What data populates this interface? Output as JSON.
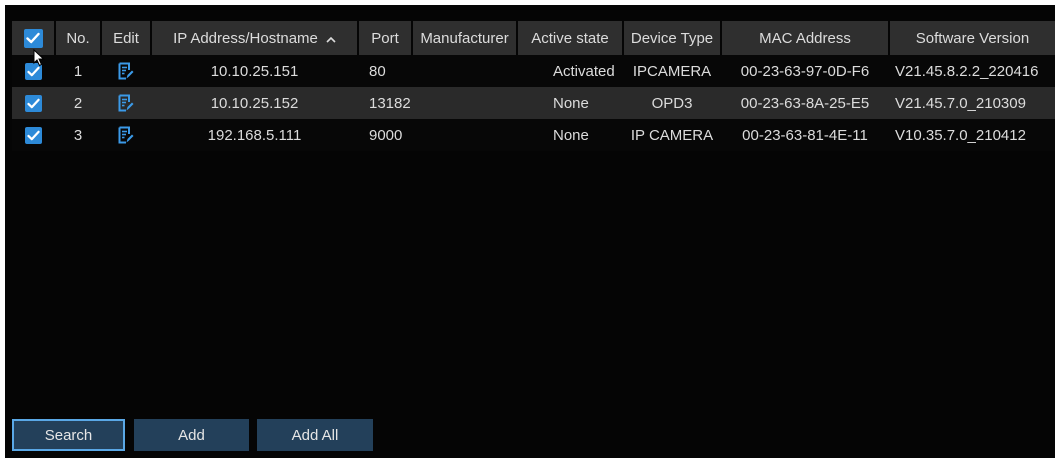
{
  "table": {
    "columns": [
      "",
      "No.",
      "Edit",
      "IP Address/Hostname",
      "Port",
      "Manufacturer",
      "Active state",
      "Device Type",
      "MAC Address",
      "Software Version"
    ],
    "sort_column": "IP Address/Hostname",
    "sort_direction": "ascending",
    "select_all_checked": true,
    "rows": [
      {
        "checked": true,
        "no": "1",
        "ip": "10.10.25.151",
        "port": "80",
        "manufacturer": "",
        "active_state": "Activated",
        "device_type": "IPCAMERA",
        "mac": "00-23-63-97-0D-F6",
        "version": "V21.45.8.2.2_220416"
      },
      {
        "checked": true,
        "no": "2",
        "ip": "10.10.25.152",
        "port": "13182",
        "manufacturer": "",
        "active_state": "None",
        "device_type": "OPD3",
        "mac": "00-23-63-8A-25-E5",
        "version": "V21.45.7.0_210309"
      },
      {
        "checked": true,
        "no": "3",
        "ip": "192.168.5.111",
        "port": "9000",
        "manufacturer": "",
        "active_state": "None",
        "device_type": "IP CAMERA",
        "mac": "00-23-63-81-4E-11",
        "version": "V10.35.7.0_210412"
      }
    ]
  },
  "buttons": {
    "search": "Search",
    "add": "Add",
    "add_all": "Add All"
  },
  "icons": {
    "checkbox": "checkmark-icon",
    "edit": "edit-icon",
    "sort": "sort-ascending-icon",
    "cursor": "mouse-pointer-icon"
  },
  "colors": {
    "background": "#050505",
    "header_bg": "#2f2f2f",
    "alt_row_bg": "#2a2a2a",
    "checkbox_blue": "#2d8ad8",
    "edit_icon_blue": "#3b9ae8",
    "button_bg": "#23405a",
    "button_focus_border": "#5aa8e6",
    "text": "#dcdcdc"
  }
}
